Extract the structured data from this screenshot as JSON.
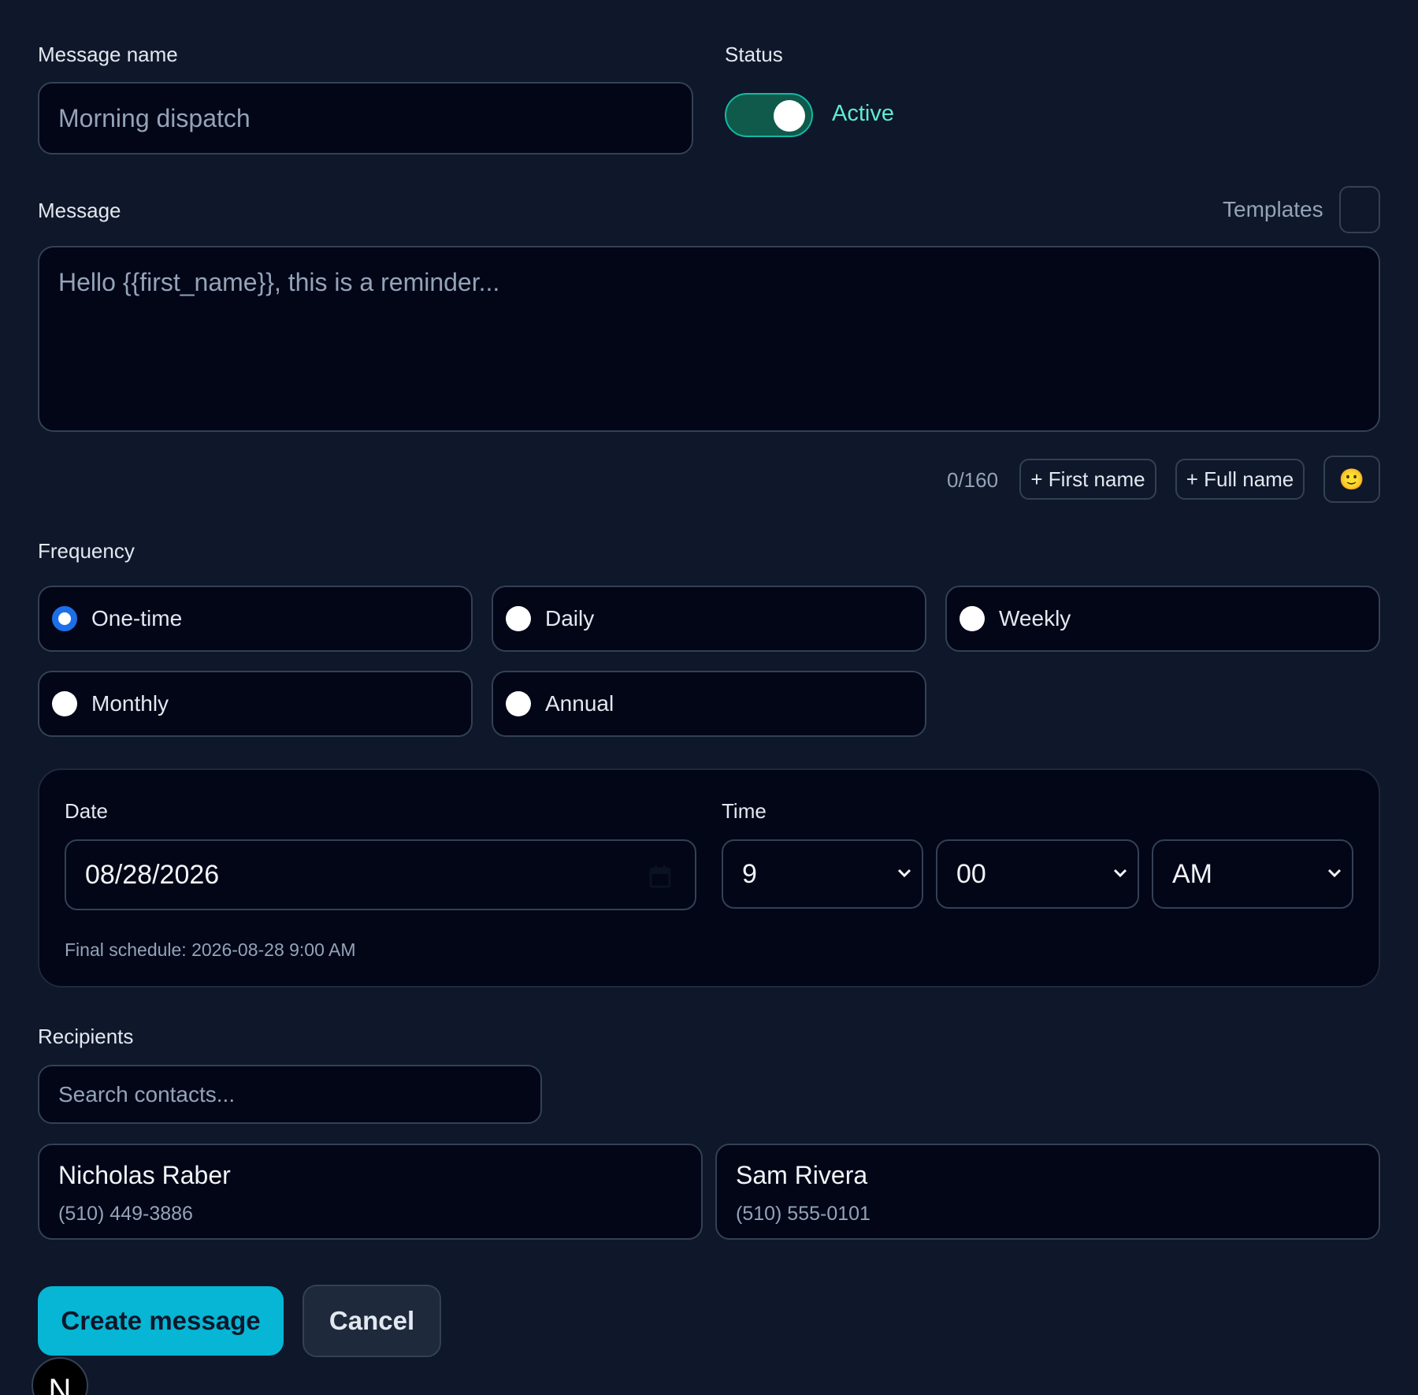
{
  "colors": {
    "background": "#0f172a",
    "accent": "#06b6d4",
    "status_active": "#5eead4",
    "radio_checked": "#1d6fe8"
  },
  "message_name": {
    "label": "Message name",
    "placeholder": "Morning dispatch"
  },
  "status": {
    "label": "Status",
    "value": "Active",
    "enabled": true
  },
  "message": {
    "label": "Message",
    "templates_label": "Templates",
    "placeholder": "Hello {{first_name}}, this is a reminder...",
    "char_count": "0/160",
    "insert_first_name": "+ First name",
    "insert_full_name": "+ Full name",
    "emoji": "🙂"
  },
  "frequency": {
    "label": "Frequency",
    "selected": "One-time",
    "options": [
      "One-time",
      "Daily",
      "Weekly",
      "Monthly",
      "Annual"
    ]
  },
  "schedule": {
    "date_label": "Date",
    "date_value": "08/28/2026",
    "time_label": "Time",
    "hour": "9",
    "minute": "00",
    "period": "AM",
    "final": "Final schedule: 2026-08-28 9:00 AM"
  },
  "recipients": {
    "label": "Recipients",
    "search_placeholder": "Search contacts...",
    "contacts": [
      {
        "name": "Nicholas Raber",
        "phone": "(510) 449-3886"
      },
      {
        "name": "Sam Rivera",
        "phone": "(510) 555-0101"
      }
    ]
  },
  "actions": {
    "create": "Create message",
    "cancel": "Cancel"
  },
  "avatar": {
    "letter": "N"
  }
}
